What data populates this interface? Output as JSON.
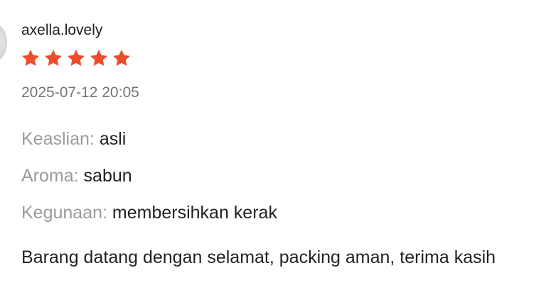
{
  "review": {
    "username": "axella.lovely",
    "rating": 5,
    "rating_max": 5,
    "star_color": "#ee4d2d",
    "timestamp": "2025-07-12 20:05",
    "attributes": [
      {
        "key": "Keaslian:",
        "value": "asli"
      },
      {
        "key": "Aroma:",
        "value": "sabun"
      },
      {
        "key": "Kegunaan:",
        "value": "membersihkan kerak"
      }
    ],
    "comment": "Barang datang dengan selamat, packing aman, terima kasih"
  }
}
